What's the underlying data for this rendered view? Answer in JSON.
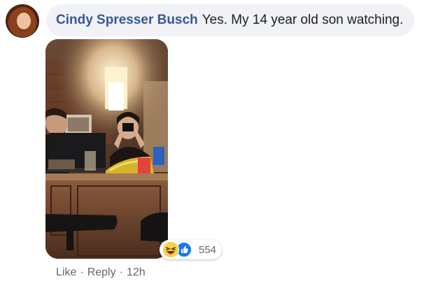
{
  "comment": {
    "author": "Cindy Spresser Busch",
    "text": "Yes. My 14 year old son watching.",
    "reactions": {
      "icons": [
        "haha-icon",
        "like-icon"
      ],
      "count": "554"
    },
    "actions": {
      "like": "Like",
      "separator": "·",
      "reply": "Reply",
      "timestamp": "12h"
    }
  },
  "colors": {
    "author": "#385898",
    "bubble": "#f0f2f5",
    "meta": "#65676b",
    "like_blue": "#1877f2",
    "haha_yellow": "#f7d04b"
  }
}
